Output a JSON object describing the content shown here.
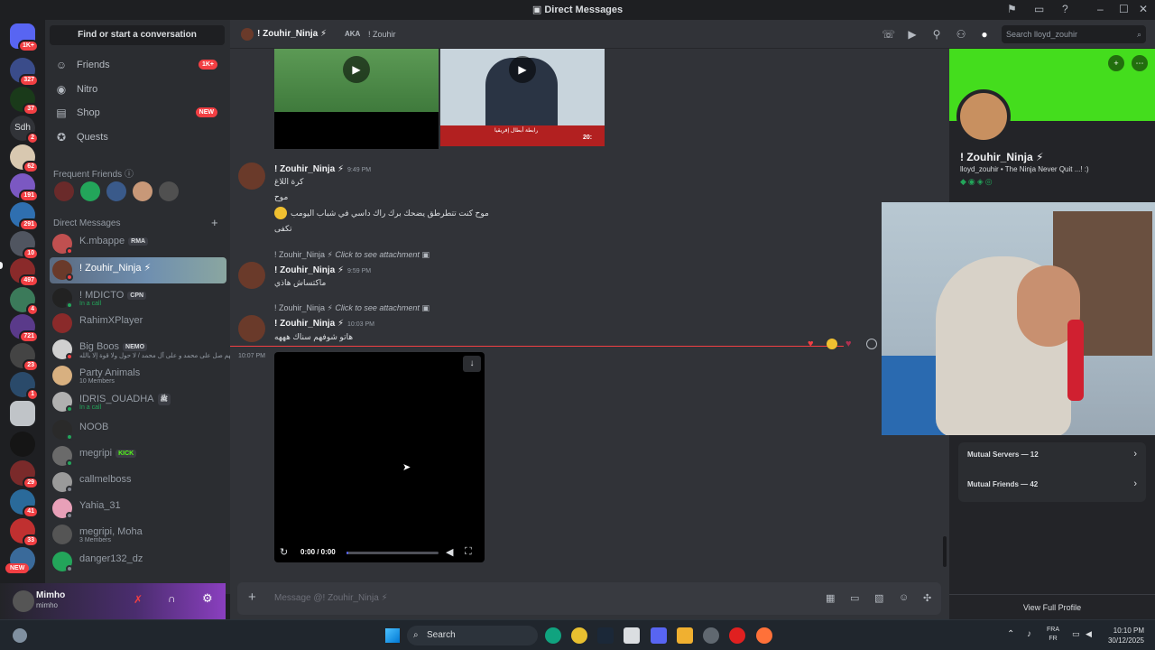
{
  "window": {
    "title": "Direct Messages"
  },
  "guild_badges": [
    "1K+",
    "327",
    "37",
    "2",
    "62",
    "191",
    "291",
    "10",
    "497",
    "4",
    "721",
    "23",
    "1",
    "29",
    "41",
    "33"
  ],
  "guild_sdh": "Sdh",
  "new_pill": "NEW",
  "sidebar": {
    "find": "Find or start a conversation",
    "nav": [
      {
        "label": "Friends",
        "badge": "1K+"
      },
      {
        "label": "Nitro",
        "badge": ""
      },
      {
        "label": "Shop",
        "badge": "NEW"
      },
      {
        "label": "Quests",
        "badge": ""
      }
    ],
    "frequent_label": "Frequent Friends",
    "dm_label": "Direct Messages",
    "dms": [
      {
        "name": "K.mbappe",
        "tag": "RMA",
        "sub": ""
      },
      {
        "name": "! Zouhir_Ninja ⚡",
        "tag": "",
        "sub": ""
      },
      {
        "name": "! MDICTO",
        "tag": "CPN",
        "sub": "In a call"
      },
      {
        "name": "RahimXPlayer",
        "tag": "",
        "sub": ""
      },
      {
        "name": "Big Boos",
        "tag": "NEMO",
        "sub": "اللهم صل على محمد و على آل محمد / لا حول ولا قوة إلا بالله"
      },
      {
        "name": "Party Animals",
        "tag": "",
        "sub": "10 Members"
      },
      {
        "name": "IDRIS_OUADHA",
        "tag": "ﷺ",
        "sub": "In a call"
      },
      {
        "name": "NOOB",
        "tag": "",
        "sub": ""
      },
      {
        "name": "megripi",
        "tag": "KICK",
        "sub": ""
      },
      {
        "name": "callmelboss",
        "tag": "",
        "sub": ""
      },
      {
        "name": "Yahia_31",
        "tag": "",
        "sub": ""
      },
      {
        "name": "megripi, Moha",
        "tag": "",
        "sub": "3 Members"
      },
      {
        "name": "danger132_dz",
        "tag": "",
        "sub": ""
      }
    ]
  },
  "user": {
    "name": "Mimho",
    "handle": "mimho"
  },
  "header": {
    "name": "! Zouhir_Ninja ⚡",
    "aka": "AKA",
    "aka_name": "! Zouhir",
    "search_placeholder": "Search lloyd_zouhir"
  },
  "messages": [
    {
      "author": "! Zouhir_Ninja ⚡",
      "time": "9:49 PM",
      "lines": [
        "كرة اللاغ",
        "موح",
        "موح كنت تتطرطق يضحك برك راك داسي في شباب اليومب",
        "تكفى"
      ]
    },
    {
      "reply_author": "! Zouhir_Ninja ⚡",
      "reply_text": "Click to see attachment",
      "author": "! Zouhir_Ninja ⚡",
      "time": "9:59 PM",
      "lines": [
        "ماكتساش هاذي"
      ]
    },
    {
      "reply_author": "! Zouhir_Ninja ⚡",
      "reply_text": "Click to see attachment",
      "author": "! Zouhir_Ninja ⚡",
      "time": "10:03 PM",
      "lines": [
        "هاتو شوفهم سناك هههه"
      ]
    }
  ],
  "video": {
    "timestamp": "10:07 PM",
    "time_display": "0:00 / 0:00",
    "progress": 0.0
  },
  "composer": {
    "placeholder": "Message @! Zouhir_Ninja ⚡"
  },
  "profile": {
    "name": "! Zouhir_Ninja ⚡",
    "handle_line": "lloyd_zouhir • The Ninja Never Quit ...! :)",
    "mutual_servers": "Mutual Servers — 12",
    "mutual_friends": "Mutual Friends — 42",
    "view_full": "View Full Profile"
  },
  "thumb_caption": "رابطة أبطال إفريقيا",
  "thumb_time": "20:",
  "taskbar": {
    "search": "Search",
    "lang1": "FRA",
    "lang2": "FR",
    "time": "10:10 PM",
    "date": "30/12/2025"
  }
}
